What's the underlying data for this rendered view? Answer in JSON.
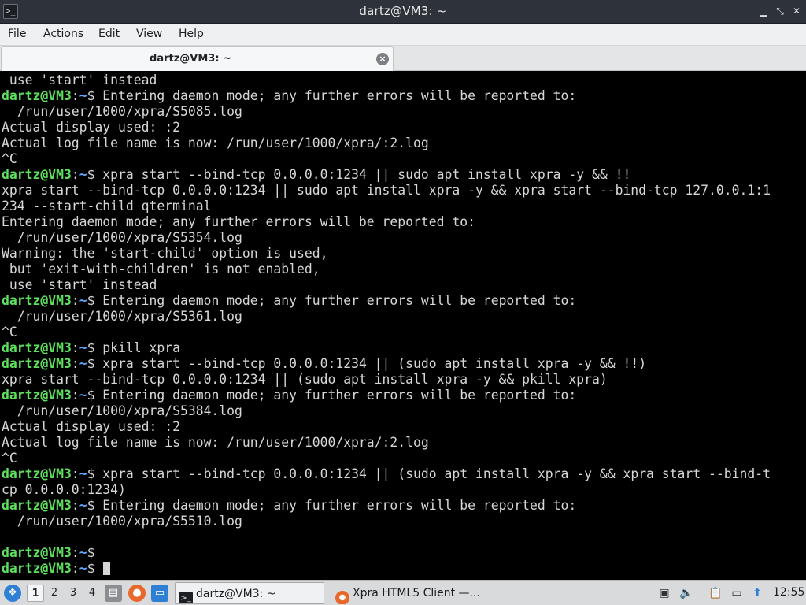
{
  "window": {
    "title": "dartz@VM3: ~"
  },
  "menubar": {
    "items": [
      "File",
      "Actions",
      "Edit",
      "View",
      "Help"
    ]
  },
  "tabs": [
    {
      "label": "dartz@VM3: ~",
      "active": true
    }
  ],
  "terminal": {
    "lines": [
      {
        "text": " use 'start' instead"
      },
      {
        "prompt": true,
        "user": "dartz@VM3",
        "path": "~",
        "text": "$ Entering daemon mode; any further errors will be reported to:"
      },
      {
        "text": "  /run/user/1000/xpra/S5085.log"
      },
      {
        "text": "Actual display used: :2"
      },
      {
        "text": "Actual log file name is now: /run/user/1000/xpra/:2.log"
      },
      {
        "text": "^C"
      },
      {
        "prompt": true,
        "user": "dartz@VM3",
        "path": "~",
        "text": "$ xpra start --bind-tcp 0.0.0.0:1234 || sudo apt install xpra -y && !!"
      },
      {
        "text": "xpra start --bind-tcp 0.0.0.0:1234 || sudo apt install xpra -y && xpra start --bind-tcp 127.0.0.1:1"
      },
      {
        "text": "234 --start-child qterminal"
      },
      {
        "text": "Entering daemon mode; any further errors will be reported to:"
      },
      {
        "text": "  /run/user/1000/xpra/S5354.log"
      },
      {
        "text": "Warning: the 'start-child' option is used,"
      },
      {
        "text": " but 'exit-with-children' is not enabled,"
      },
      {
        "text": " use 'start' instead"
      },
      {
        "prompt": true,
        "user": "dartz@VM3",
        "path": "~",
        "text": "$ Entering daemon mode; any further errors will be reported to:"
      },
      {
        "text": "  /run/user/1000/xpra/S5361.log"
      },
      {
        "text": "^C"
      },
      {
        "prompt": true,
        "user": "dartz@VM3",
        "path": "~",
        "text": "$ pkill xpra"
      },
      {
        "prompt": true,
        "user": "dartz@VM3",
        "path": "~",
        "text": "$ xpra start --bind-tcp 0.0.0.0:1234 || (sudo apt install xpra -y && !!)"
      },
      {
        "text": "xpra start --bind-tcp 0.0.0.0:1234 || (sudo apt install xpra -y && pkill xpra)"
      },
      {
        "prompt": true,
        "user": "dartz@VM3",
        "path": "~",
        "text": "$ Entering daemon mode; any further errors will be reported to:"
      },
      {
        "text": "  /run/user/1000/xpra/S5384.log"
      },
      {
        "text": "Actual display used: :2"
      },
      {
        "text": "Actual log file name is now: /run/user/1000/xpra/:2.log"
      },
      {
        "text": "^C"
      },
      {
        "prompt": true,
        "user": "dartz@VM3",
        "path": "~",
        "text": "$ xpra start --bind-tcp 0.0.0.0:1234 || (sudo apt install xpra -y && xpra start --bind-t"
      },
      {
        "text": "cp 0.0.0.0:1234)"
      },
      {
        "prompt": true,
        "user": "dartz@VM3",
        "path": "~",
        "text": "$ Entering daemon mode; any further errors will be reported to:"
      },
      {
        "text": "  /run/user/1000/xpra/S5510.log"
      },
      {
        "text": ""
      },
      {
        "prompt": true,
        "user": "dartz@VM3",
        "path": "~",
        "text": "$"
      },
      {
        "prompt": true,
        "user": "dartz@VM3",
        "path": "~",
        "text": "$ ",
        "cursor": true
      }
    ]
  },
  "taskbar": {
    "workspaces": [
      "1",
      "2",
      "3",
      "4"
    ],
    "active_workspace": "1",
    "quick_launch": [
      "file-manager-icon",
      "firefox-icon",
      "desktop-icon"
    ],
    "tasks": [
      {
        "label": "dartz@VM3: ~",
        "icon": "terminal-icon",
        "active": true
      },
      {
        "label": "Xpra HTML5 Client —...",
        "icon": "firefox-icon",
        "active": false
      }
    ],
    "tray": [
      "monitor-icon",
      "volume-icon",
      "clipboard-icon",
      "network-icon"
    ],
    "clock": "12:55"
  },
  "colors": {
    "terminal_bg": "#000000",
    "terminal_fg": "#d7d7d7",
    "prompt_user": "#5ee05e",
    "prompt_path": "#5fa8ff"
  }
}
